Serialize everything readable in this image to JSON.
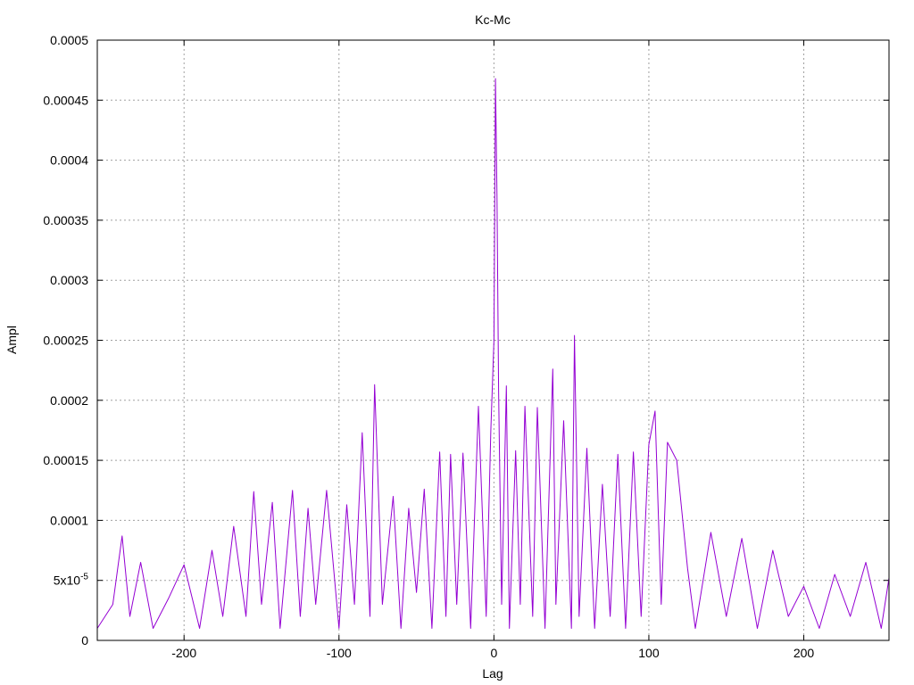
{
  "chart_data": {
    "type": "line",
    "title": "Kc-Mc",
    "xlabel": "Lag",
    "ylabel": "Ampl",
    "xlim": [
      -256,
      255
    ],
    "ylim": [
      0,
      0.0005
    ],
    "grid": true,
    "legend": "none",
    "series_color": "#9400d3",
    "x_ticks": [
      -200,
      -100,
      0,
      100,
      200
    ],
    "x_tick_labels": [
      "-200",
      "-100",
      "0",
      "100",
      "200"
    ],
    "y_ticks": [
      0,
      5e-05,
      0.0001,
      0.00015,
      0.0002,
      0.00025,
      0.0003,
      0.00035,
      0.0004,
      0.00045,
      0.0005
    ],
    "y_tick_labels": [
      "0",
      "5x10-5",
      "0.0001",
      "0.00015",
      "0.0002",
      "0.00025",
      "0.0003",
      "0.00035",
      "0.0004",
      "0.00045",
      "0.0005"
    ],
    "series": [
      {
        "x": [
          -256,
          -246,
          -240,
          -235,
          -228,
          -220,
          -210,
          -200,
          -190,
          -182,
          -175,
          -168,
          -160,
          -155,
          -150,
          -143,
          -138,
          -130,
          -125,
          -120,
          -115,
          -108,
          -100,
          -95,
          -90,
          -85,
          -80,
          -77,
          -72,
          -65,
          -60,
          -55,
          -50,
          -45,
          -40,
          -35,
          -31,
          -28,
          -24,
          -20,
          -15,
          -10,
          -5,
          -2,
          0,
          1,
          2,
          3,
          5,
          8,
          10,
          14,
          17,
          20,
          25,
          28,
          33,
          38,
          40,
          45,
          50,
          52,
          55,
          60,
          65,
          70,
          75,
          80,
          85,
          90,
          95,
          100,
          104,
          108,
          112,
          118,
          125,
          130,
          140,
          150,
          160,
          170,
          180,
          190,
          200,
          210,
          220,
          230,
          240,
          250,
          255
        ],
        "y": [
          1e-05,
          3e-05,
          8.7e-05,
          2e-05,
          6.5e-05,
          1e-05,
          3.5e-05,
          6.3e-05,
          1e-05,
          7.5e-05,
          2e-05,
          9.5e-05,
          2e-05,
          0.000124,
          3e-05,
          0.000115,
          1e-05,
          0.000125,
          2e-05,
          0.00011,
          3e-05,
          0.000125,
          1e-05,
          0.000113,
          3e-05,
          0.000173,
          2e-05,
          0.000213,
          3e-05,
          0.00012,
          1e-05,
          0.00011,
          4e-05,
          0.000126,
          1e-05,
          0.000157,
          2e-05,
          0.000155,
          3e-05,
          0.000156,
          1e-05,
          0.000195,
          2e-05,
          0.000175,
          0.00025,
          0.000468,
          0.00037,
          0.000208,
          3e-05,
          0.000212,
          1e-05,
          0.000158,
          3e-05,
          0.000195,
          2e-05,
          0.000194,
          1e-05,
          0.000226,
          3e-05,
          0.000183,
          1e-05,
          0.000254,
          2e-05,
          0.00016,
          1e-05,
          0.00013,
          2e-05,
          0.000155,
          1e-05,
          0.000157,
          2e-05,
          0.000163,
          0.000191,
          3e-05,
          0.000165,
          0.00015,
          6e-05,
          1e-05,
          9e-05,
          2e-05,
          8.5e-05,
          1e-05,
          7.5e-05,
          2e-05,
          4.5e-05,
          1e-05,
          5.5e-05,
          2e-05,
          6.5e-05,
          1e-05,
          5.2e-05
        ]
      }
    ]
  }
}
